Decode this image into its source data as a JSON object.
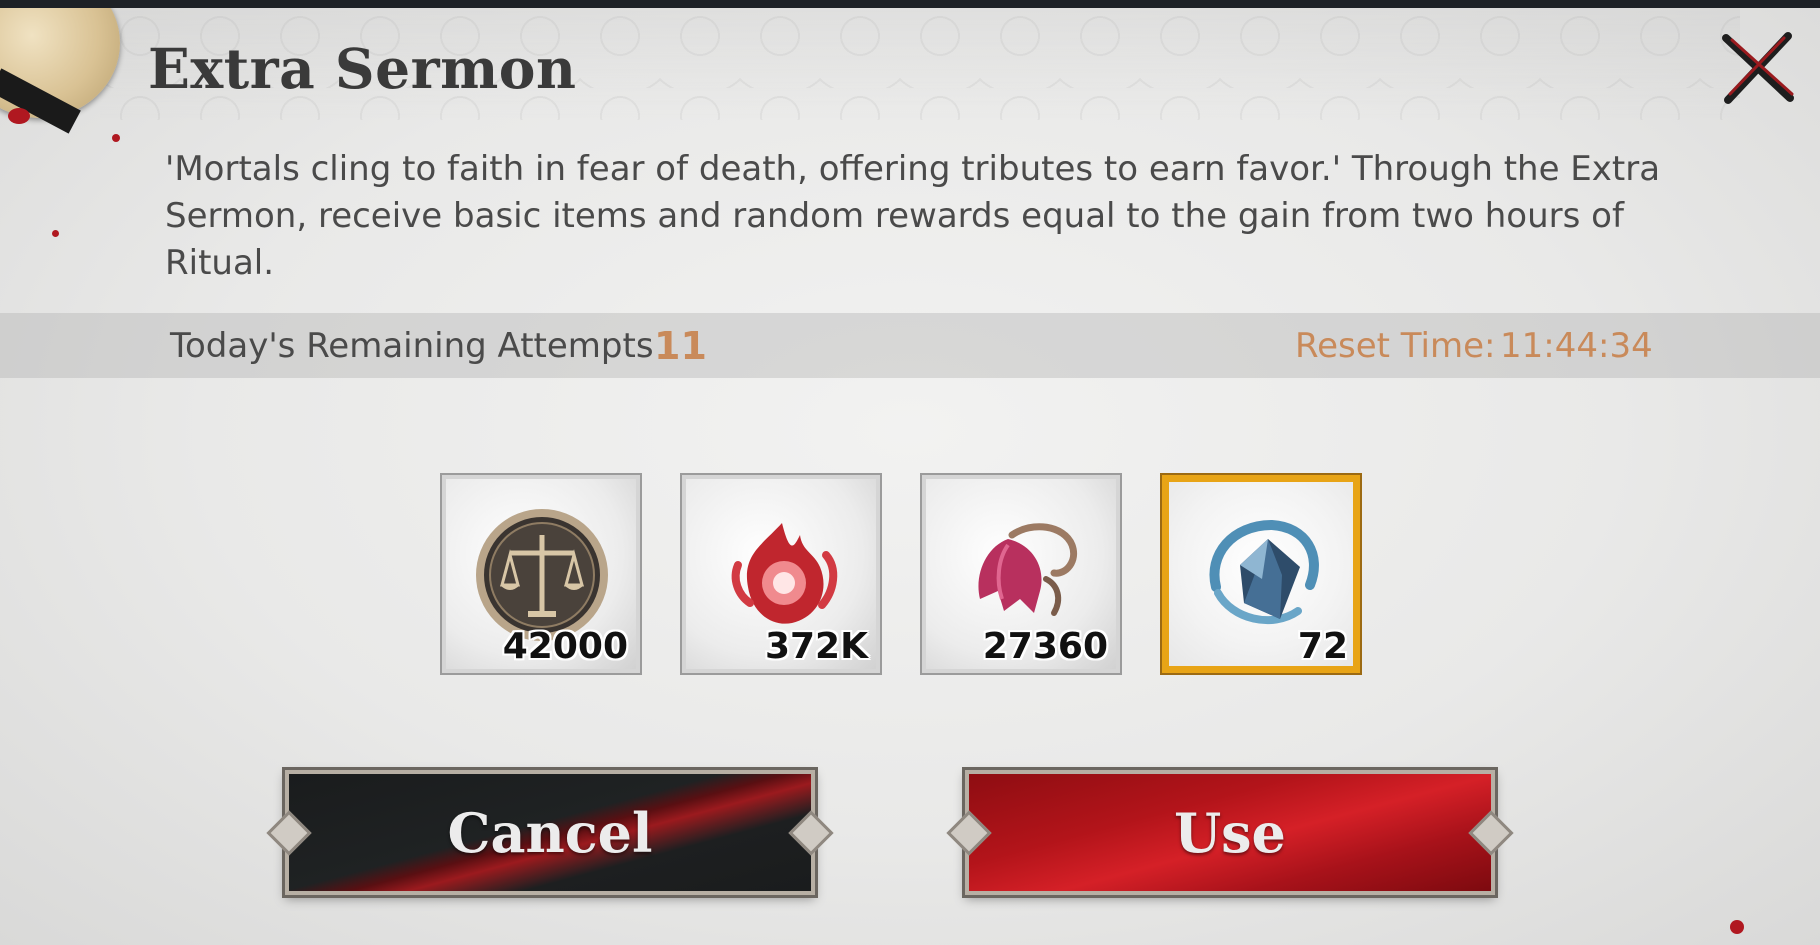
{
  "dialog": {
    "title": "Extra Sermon",
    "description_line1": "'Mortals cling to faith in fear of death, offering tributes to earn favor.' Through the Extra",
    "description_line2": "Sermon, receive basic items and random rewards equal to the gain from two hours of Ritual."
  },
  "attempts": {
    "label": "Today's Remaining Attempts",
    "value": "11"
  },
  "reset": {
    "label": "Reset Time:",
    "value": "11:44:34"
  },
  "rewards": [
    {
      "icon": "balance-scale-coin-icon",
      "quantity": "42000",
      "rarity": "common"
    },
    {
      "icon": "crimson-flame-essence-icon",
      "quantity": "372K",
      "rarity": "common"
    },
    {
      "icon": "pink-bellflower-icon",
      "quantity": "27360",
      "rarity": "common"
    },
    {
      "icon": "blue-crystal-shard-icon",
      "quantity": "72",
      "rarity": "gold"
    }
  ],
  "buttons": {
    "cancel": "Cancel",
    "use": "Use"
  },
  "colors": {
    "accent_orange": "#c98a5a",
    "use_red": "#c01820",
    "cancel_black": "#1c1e1f",
    "gold_frame": "#e8a416"
  }
}
